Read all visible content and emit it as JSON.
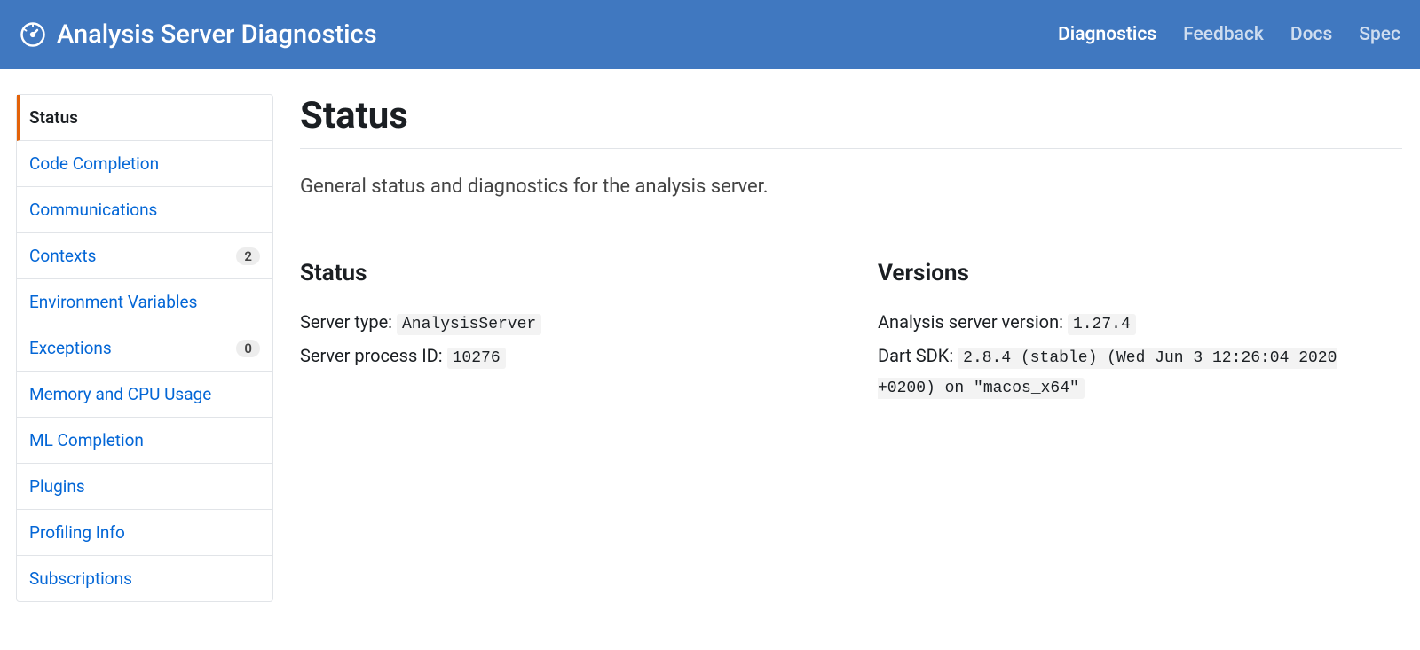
{
  "header": {
    "title": "Analysis Server Diagnostics",
    "nav": {
      "diagnostics": "Diagnostics",
      "feedback": "Feedback",
      "docs": "Docs",
      "spec": "Spec"
    }
  },
  "sidebar": {
    "items": [
      {
        "label": "Status",
        "active": true
      },
      {
        "label": "Code Completion"
      },
      {
        "label": "Communications"
      },
      {
        "label": "Contexts",
        "badge": "2"
      },
      {
        "label": "Environment Variables"
      },
      {
        "label": "Exceptions",
        "badge": "0"
      },
      {
        "label": "Memory and CPU Usage"
      },
      {
        "label": "ML Completion"
      },
      {
        "label": "Plugins"
      },
      {
        "label": "Profiling Info"
      },
      {
        "label": "Subscriptions"
      }
    ]
  },
  "main": {
    "title": "Status",
    "subtitle": "General status and diagnostics for the analysis server.",
    "status": {
      "heading": "Status",
      "server_type_label": "Server type: ",
      "server_type_value": "AnalysisServer",
      "server_pid_label": "Server process ID: ",
      "server_pid_value": "10276"
    },
    "versions": {
      "heading": "Versions",
      "analysis_server_label": "Analysis server version: ",
      "analysis_server_value": "1.27.4",
      "dart_sdk_label": "Dart SDK: ",
      "dart_sdk_value": "2.8.4 (stable) (Wed Jun 3 12:26:04 2020 +0200) on \"macos_x64\""
    }
  }
}
